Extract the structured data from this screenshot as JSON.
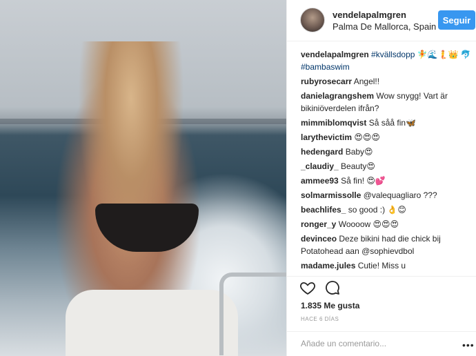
{
  "post": {
    "username": "vendelapalmgren",
    "location": "Palma De Mallorca, Spain",
    "follow_label": "Seguir"
  },
  "comments": [
    {
      "user": "vendelapalmgren",
      "text": "#kvällsdopp 🧚🌊🧜👑 🐬#bambaswim"
    },
    {
      "user": "rubyrosecarr",
      "text": "Angel!!"
    },
    {
      "user": "danielagrangshem",
      "text": "Wow snygg! Vart är bikiniöverdelen ifrån?"
    },
    {
      "user": "mimmiblomqvist",
      "text": "Så såå fin🦋"
    },
    {
      "user": "larythevictim",
      "text": "😍😍😍"
    },
    {
      "user": "hedengard",
      "text": "Baby😍"
    },
    {
      "user": "_claudiy_",
      "text": "Beauty😍"
    },
    {
      "user": "ammee93",
      "text": "Så fin! 😍💕"
    },
    {
      "user": "solmarmissolle",
      "text": "@valequagliaro ???"
    },
    {
      "user": "beachlifes_",
      "text": "so good :) 👌😊"
    },
    {
      "user": "ronger_y",
      "text": "Woooow 😍😍😍"
    },
    {
      "user": "devinceo",
      "text": "Deze bikini had die chick bij Potatohead aan @sophievdbol"
    },
    {
      "user": "madame.jules",
      "text": "Cutie! Miss u"
    }
  ],
  "likes_text": "1.835 Me gusta",
  "time_text": "HACE 6 DÍAS",
  "add_comment_placeholder": "Añade un comentario...",
  "more_label": "•••",
  "icons": {
    "like": "heart-icon",
    "comment": "comment-icon",
    "more": "more-options-icon"
  },
  "colors": {
    "accent": "#3897f0",
    "link": "#003569"
  }
}
